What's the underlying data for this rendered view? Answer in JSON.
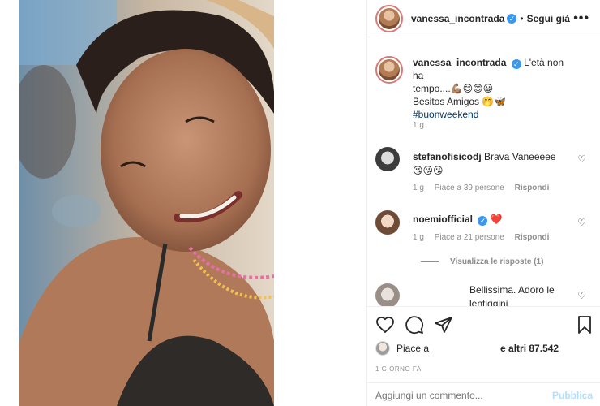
{
  "post": {
    "author": "vanessa_incontrada",
    "verified_mark": "✓",
    "dot": "•",
    "follow_label": "Segui già",
    "more_label": "•••"
  },
  "caption": {
    "author": "vanessa_incontrada",
    "line1": "L'età non ha",
    "line2": "tempo....💪🏽😊😊😀",
    "line3": "Besitos Amigos 🤭🦋",
    "hashtag": "#buonweekend",
    "time": "1 g"
  },
  "comments": [
    {
      "author": "stefanofisicodj",
      "text": "Brava Vaneeeee",
      "emoji": "😘😘😘",
      "time": "1 g",
      "likes": "Piace a 39 persone",
      "reply": "Rispondi"
    },
    {
      "author": "noemiofficial",
      "text": "❤️",
      "time": "1 g",
      "likes": "Piace a 21 persone",
      "reply": "Rispondi",
      "view_replies": "Visualizza le risposte (1)"
    },
    {
      "text_line1": "Bellissima. Adoro le",
      "text_line2": "lentiggini"
    }
  ],
  "actions": {
    "liked_by_prefix": "Piace a",
    "liked_by_suffix": "e altri 87.542",
    "date": "1 GIORNO FA"
  },
  "add_comment": {
    "placeholder": "Aggiungi un commento...",
    "emoji": "☺",
    "publish_label": "Pubblica"
  },
  "icons": [
    "heart-icon",
    "comment-icon",
    "share-icon",
    "bookmark-icon",
    "more-icon",
    "verified-icon",
    "emoji-icon"
  ],
  "colors": {
    "verified": "#3897f0",
    "hashtag": "#00376b",
    "muted": "#8e8e8e",
    "publish": "#b2dffc",
    "heart_red": "#ed4956"
  }
}
